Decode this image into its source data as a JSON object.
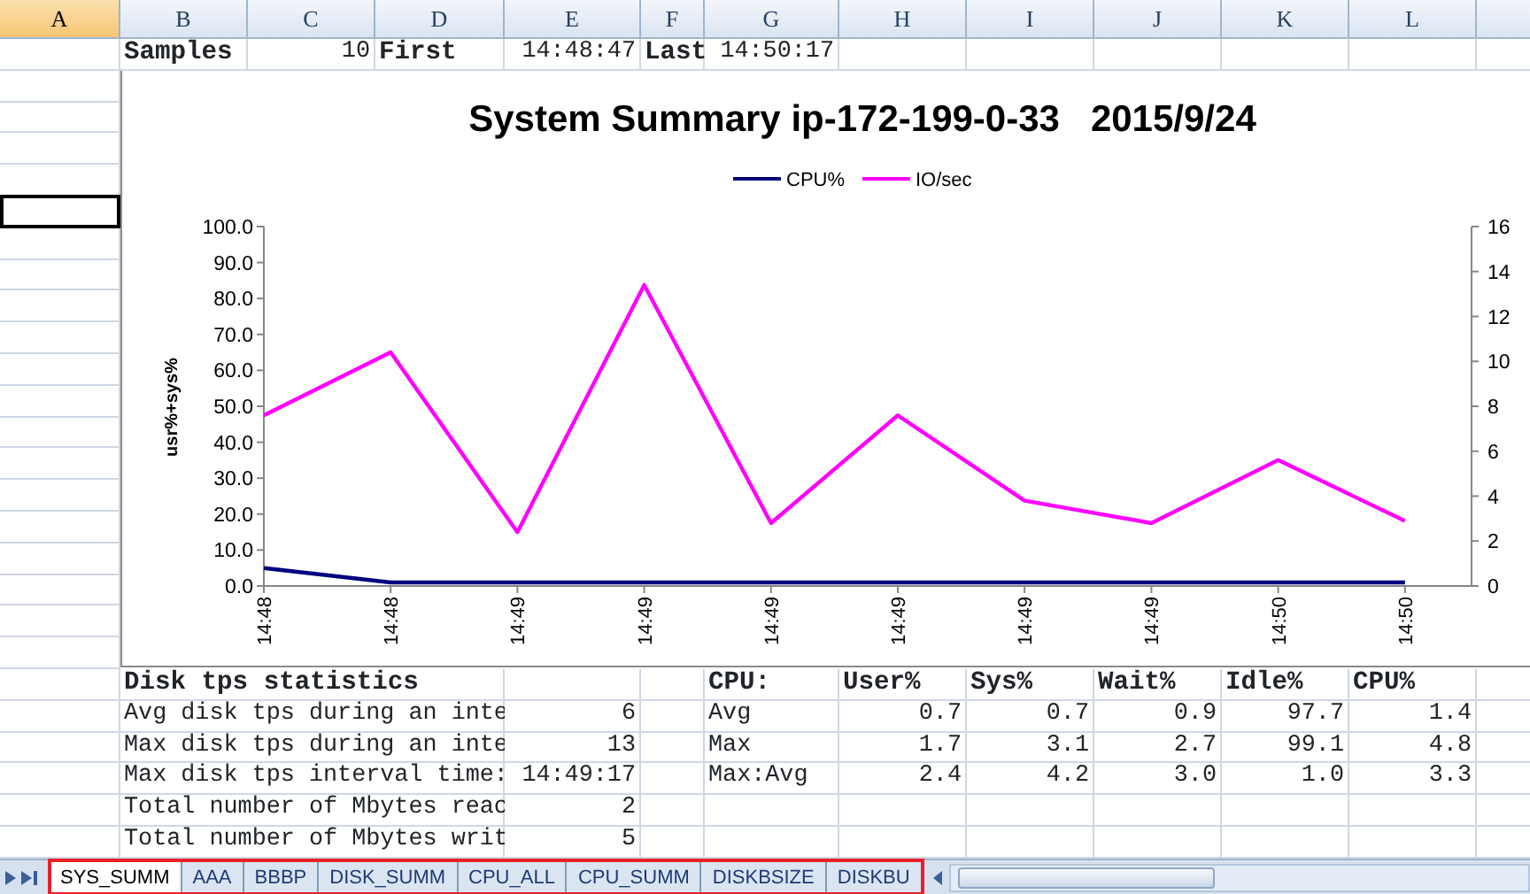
{
  "columns": [
    {
      "label": "A",
      "selected": true
    },
    {
      "label": "B",
      "selected": false
    },
    {
      "label": "C",
      "selected": false
    },
    {
      "label": "D",
      "selected": false
    },
    {
      "label": "E",
      "selected": false
    },
    {
      "label": "F",
      "selected": false
    },
    {
      "label": "G",
      "selected": false
    },
    {
      "label": "H",
      "selected": false
    },
    {
      "label": "I",
      "selected": false
    },
    {
      "label": "J",
      "selected": false
    },
    {
      "label": "K",
      "selected": false
    },
    {
      "label": "L",
      "selected": false
    }
  ],
  "column_a_cells": [
    {
      "selected": false
    },
    {
      "selected": false
    },
    {
      "selected": false
    },
    {
      "selected": false
    },
    {
      "selected": false
    },
    {
      "selected": true
    }
  ],
  "summary_row": [
    {
      "text": "Samples",
      "kind": "label"
    },
    {
      "text": "10",
      "kind": "value"
    },
    {
      "text": "First",
      "kind": "label"
    },
    {
      "text": "14:48:47",
      "kind": "value"
    },
    {
      "text": "Last",
      "kind": "label"
    },
    {
      "text": "14:50:17",
      "kind": "value"
    }
  ],
  "chart": {
    "chart_data": {
      "type": "line",
      "title": "System Summary ip-172-199-0-33   2015/9/24",
      "ylabel": "usr%+sys%",
      "categories": [
        "14:48",
        "14:48",
        "14:49",
        "14:49",
        "14:49",
        "14:49",
        "14:49",
        "14:49",
        "14:50",
        "14:50"
      ],
      "series": [
        {
          "name": "CPU%",
          "color": "#000080",
          "values": [
            5.0,
            1.0,
            1.0,
            1.0,
            1.0,
            1.0,
            1.0,
            1.0,
            1.0,
            1.0
          ]
        },
        {
          "name": "IO/sec",
          "color": "#ff00ff",
          "axis": "y2",
          "values": [
            7.6,
            10.4,
            2.4,
            13.4,
            2.8,
            7.6,
            3.8,
            2.8,
            5.6,
            2.9
          ]
        }
      ],
      "ylim": [
        0,
        100
      ],
      "yticks": [
        {
          "value": 0,
          "label": "0.0"
        },
        {
          "value": 10,
          "label": "10.0"
        },
        {
          "value": 20,
          "label": "20.0"
        },
        {
          "value": 30,
          "label": "30.0"
        },
        {
          "value": 40,
          "label": "40.0"
        },
        {
          "value": 50,
          "label": "50.0"
        },
        {
          "value": 60,
          "label": "60.0"
        },
        {
          "value": 70,
          "label": "70.0"
        },
        {
          "value": 80,
          "label": "80.0"
        },
        {
          "value": 90,
          "label": "90.0"
        },
        {
          "value": 100,
          "label": "100.0"
        }
      ],
      "y2lim": [
        0,
        16
      ],
      "y2ticks": [
        0,
        2,
        4,
        6,
        8,
        10,
        12,
        14,
        16
      ],
      "legend": "top"
    }
  },
  "disk_stats": {
    "title": "Disk tps statistics",
    "rows": [
      {
        "label": "Avg disk tps during an inte",
        "value": "6"
      },
      {
        "label": "Max disk tps during an inte",
        "value": "13"
      },
      {
        "label": "Max disk tps interval time:",
        "value": "14:49:17"
      },
      {
        "label": "Total number of Mbytes reac",
        "value": "2"
      },
      {
        "label": "Total number of Mbytes writ",
        "value": "5"
      }
    ]
  },
  "cpu_stats": {
    "header": [
      "CPU:",
      "User%",
      "Sys%",
      "Wait%",
      "Idle%",
      "CPU%"
    ],
    "rows": [
      {
        "label": "Avg",
        "values": [
          "0.7",
          "0.7",
          "0.9",
          "97.7",
          "1.4"
        ]
      },
      {
        "label": "Max",
        "values": [
          "1.7",
          "3.1",
          "2.7",
          "99.1",
          "4.8"
        ]
      },
      {
        "label": "Max:Avg",
        "values": [
          "2.4",
          "4.2",
          "3.0",
          "1.0",
          "3.3"
        ]
      }
    ]
  },
  "sheet_tabs_highlighted": true,
  "sheet_tabs": [
    {
      "label": "SYS_SUMM",
      "selected": true
    },
    {
      "label": "AAA",
      "selected": false
    },
    {
      "label": "BBBP",
      "selected": false
    },
    {
      "label": "DISK_SUMM",
      "selected": false
    },
    {
      "label": "CPU_ALL",
      "selected": false
    },
    {
      "label": "CPU_SUMM",
      "selected": false
    },
    {
      "label": "DISKBSIZE",
      "selected": false
    },
    {
      "label": "DISKBU",
      "selected": false
    }
  ]
}
